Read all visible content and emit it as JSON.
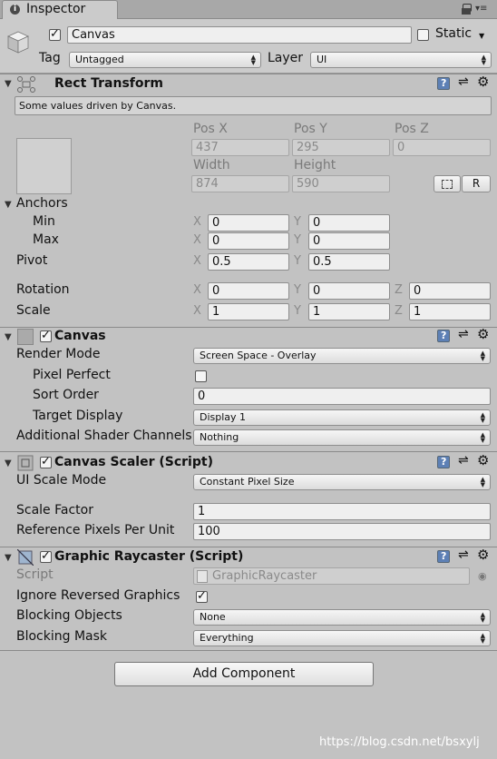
{
  "window": {
    "tab_title": "Inspector"
  },
  "header": {
    "object_name": "Canvas",
    "static_label": "Static",
    "tag_label": "Tag",
    "tag_value": "Untagged",
    "layer_label": "Layer",
    "layer_value": "UI"
  },
  "rect_transform": {
    "title": "Rect Transform",
    "info": "Some values driven by Canvas.",
    "pos_x_label": "Pos X",
    "pos_y_label": "Pos Y",
    "pos_z_label": "Pos Z",
    "pos_x": "437",
    "pos_y": "295",
    "pos_z": "0",
    "width_label": "Width",
    "height_label": "Height",
    "width": "874",
    "height": "590",
    "blueprint_btn": "",
    "raw_btn": "R",
    "anchors_label": "Anchors",
    "min_label": "Min",
    "max_label": "Max",
    "min_x": "0",
    "min_y": "0",
    "max_x": "0",
    "max_y": "0",
    "pivot_label": "Pivot",
    "pivot_x": "0.5",
    "pivot_y": "0.5",
    "rotation_label": "Rotation",
    "rot_x": "0",
    "rot_y": "0",
    "rot_z": "0",
    "scale_label": "Scale",
    "scale_x": "1",
    "scale_y": "1",
    "scale_z": "1",
    "axis_x": "X",
    "axis_y": "Y",
    "axis_z": "Z"
  },
  "canvas": {
    "title": "Canvas",
    "render_mode_label": "Render Mode",
    "render_mode": "Screen Space - Overlay",
    "pixel_perfect_label": "Pixel Perfect",
    "sort_order_label": "Sort Order",
    "sort_order": "0",
    "target_display_label": "Target Display",
    "target_display": "Display 1",
    "shader_channels_label": "Additional Shader Channels",
    "shader_channels": "Nothing"
  },
  "canvas_scaler": {
    "title": "Canvas Scaler (Script)",
    "ui_scale_mode_label": "UI Scale Mode",
    "ui_scale_mode": "Constant Pixel Size",
    "scale_factor_label": "Scale Factor",
    "scale_factor": "1",
    "ref_ppu_label": "Reference Pixels Per Unit",
    "ref_ppu": "100"
  },
  "graphic_raycaster": {
    "title": "Graphic Raycaster (Script)",
    "script_label": "Script",
    "script_value": "GraphicRaycaster",
    "ignore_reversed_label": "Ignore Reversed Graphics",
    "blocking_objects_label": "Blocking Objects",
    "blocking_objects": "None",
    "blocking_mask_label": "Blocking Mask",
    "blocking_mask": "Everything"
  },
  "footer": {
    "add_component": "Add Component",
    "watermark": "https://blog.csdn.net/bsxylj"
  },
  "colors": {
    "panel": "#c2c2c2",
    "header": "#cbcbcb",
    "help_icon": "#5d80b5"
  }
}
